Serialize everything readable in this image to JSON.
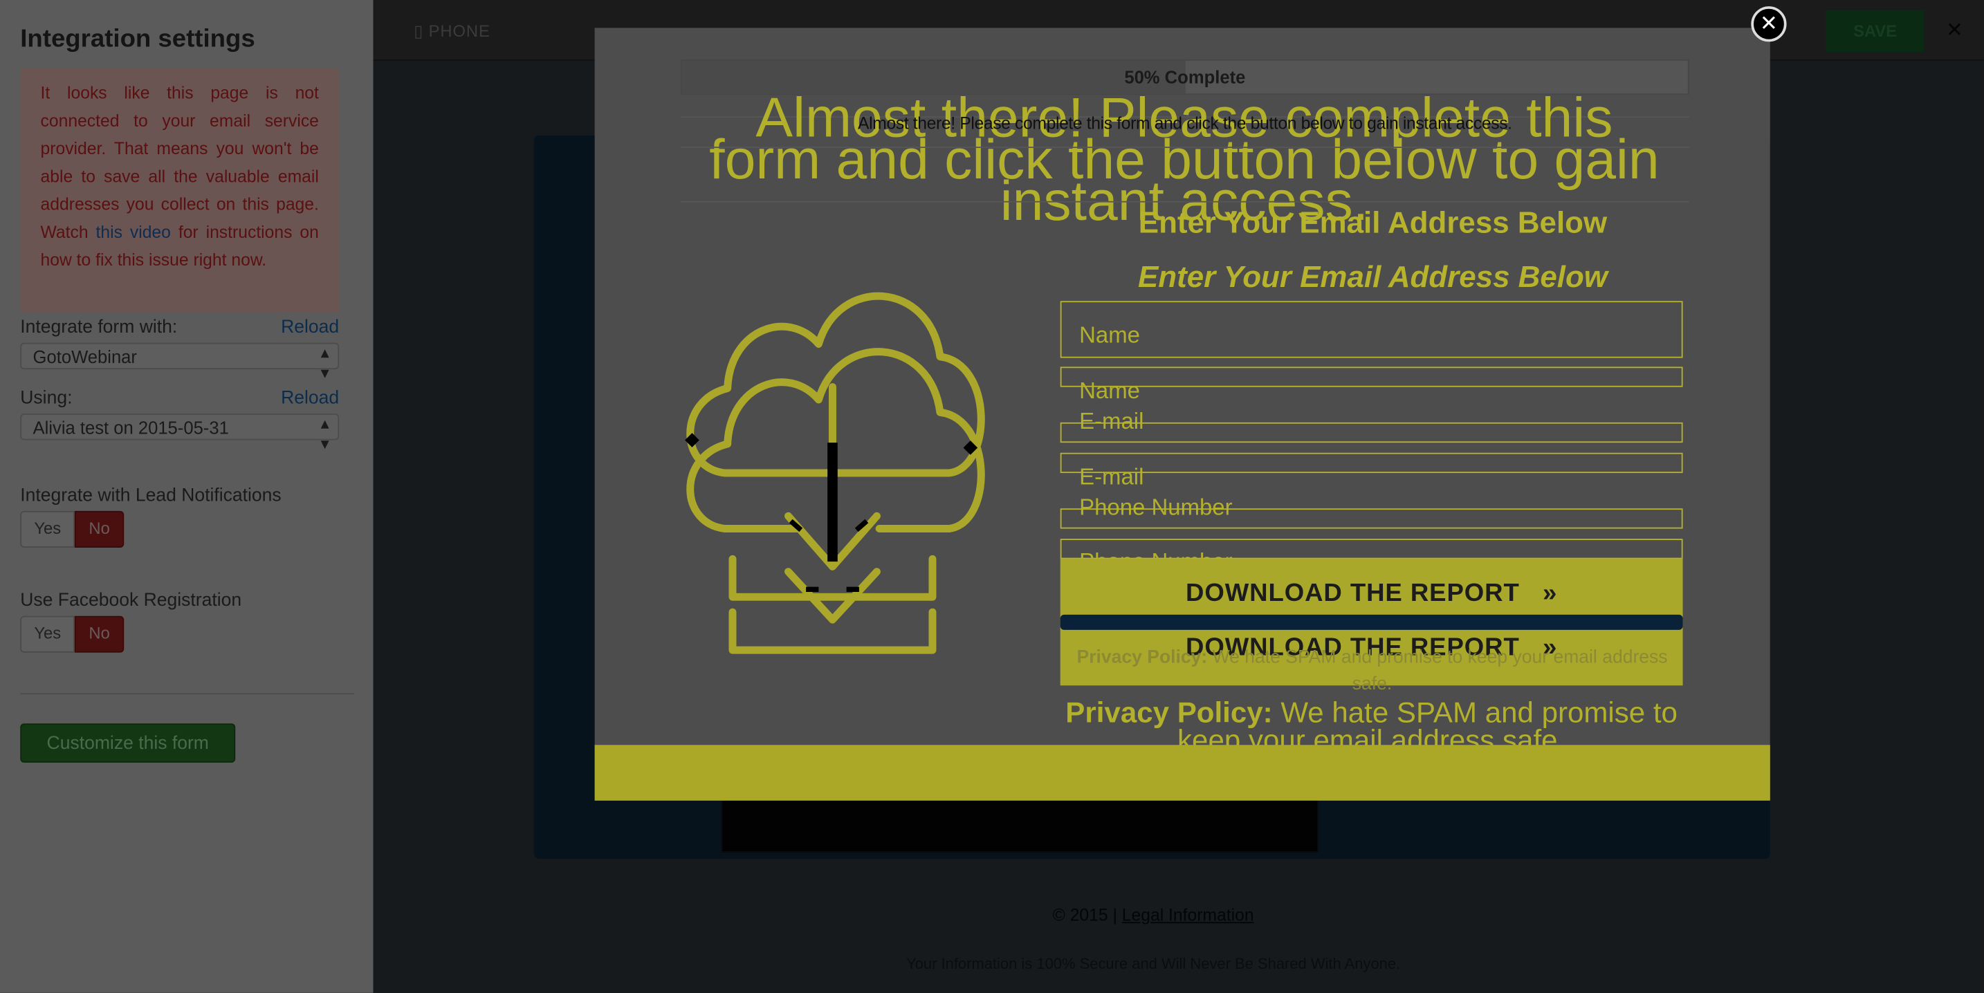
{
  "sidebar": {
    "title": "Integration settings",
    "warning": {
      "text_before": "It looks like this page is not connected to your email service provider. That means you won't be able to save all the valuable email addresses you collect on this page. Watch ",
      "link": "this video",
      "text_after": " for instructions on how to fix this issue right now."
    },
    "integrate_label": "Integrate form with:",
    "reload_label": "Reload",
    "integrate_value": "GotoWebinar",
    "using_label": "Using:",
    "using_value": "Alivia test on 2015-05-31",
    "lead_notifications_label": "Integrate with Lead Notifications",
    "facebook_label": "Use Facebook Registration",
    "yes_label": "Yes",
    "no_label": "No",
    "customize_label": "Customize this form"
  },
  "editor": {
    "device_label": "PHONE",
    "save_label": "SAVE",
    "footer_copyright": "© 2015 | ",
    "footer_link": "Legal Information",
    "footer_secure": "Your Information is 100% Secure and Will Never Be Shared With Anyone."
  },
  "modal": {
    "progress_text": "50% Complete",
    "progress_percent": 50,
    "headline": "Almost there! Please complete this form and click the button below to gain instant access.",
    "enter_email": "Enter Your Email Address Below",
    "fields": [
      "Name",
      "E-mail",
      "Phone Number"
    ],
    "button_label": "DOWNLOAD THE REPORT",
    "button_arrow": "»",
    "privacy_bold": "Privacy Policy:",
    "privacy_text": " We hate SPAM and promise to keep your email address safe.",
    "close_symbol": "✕"
  },
  "colors": {
    "accent_yellow": "#b3b02b",
    "overlay_dark": "#4d4d4d",
    "warning_red": "#5a1010"
  },
  "icons": [
    "cloud-download-icon",
    "close-icon",
    "select-arrow-icon",
    "phone-icon"
  ]
}
